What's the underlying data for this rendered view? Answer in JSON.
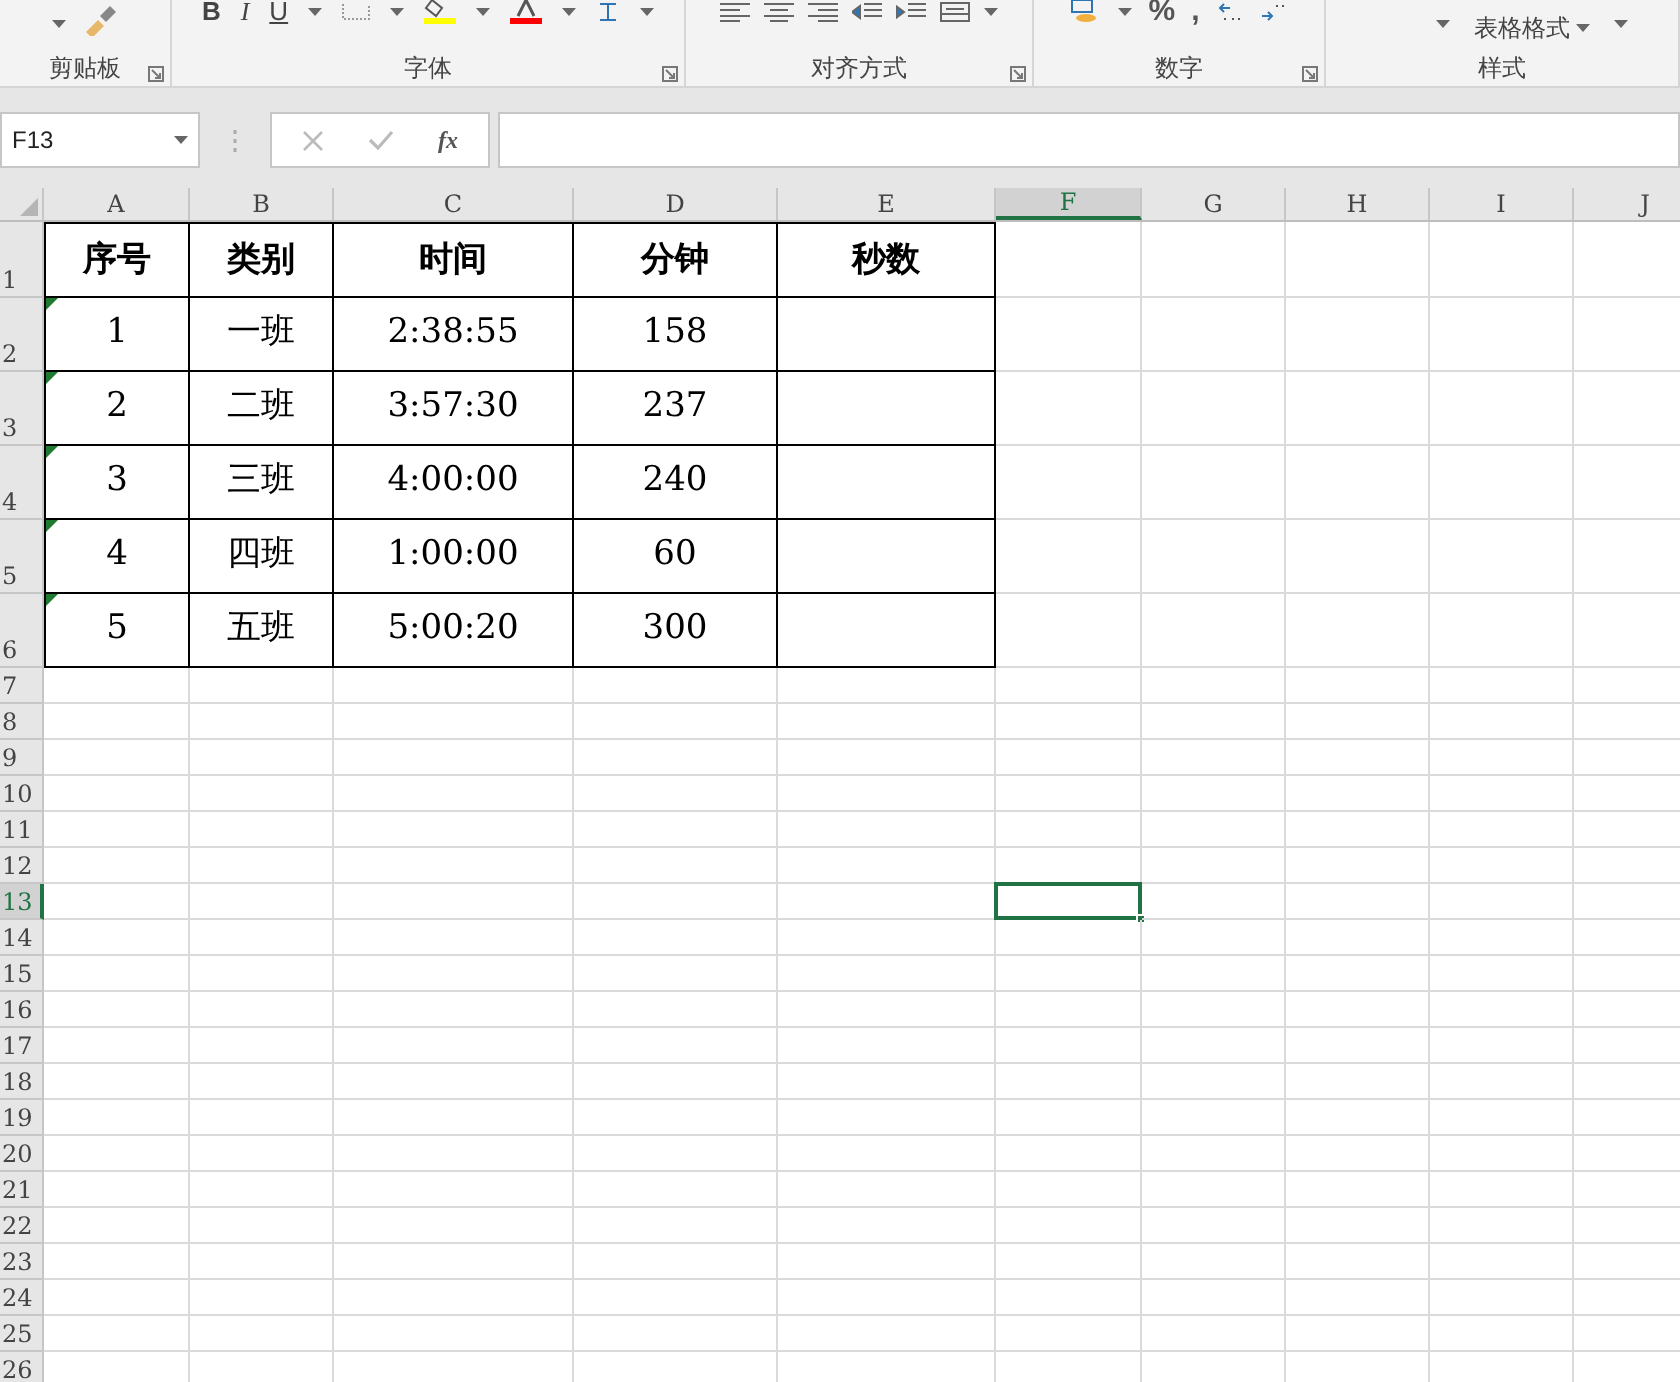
{
  "ribbon": {
    "groups": [
      {
        "kind": "clipboard",
        "label": "剪贴板"
      },
      {
        "kind": "font",
        "label": "字体",
        "buttons": [
          "B",
          "I",
          "U"
        ]
      },
      {
        "kind": "alignment",
        "label": "对齐方式"
      },
      {
        "kind": "number",
        "label": "数字",
        "buttons": [
          "%",
          ","
        ]
      },
      {
        "kind": "styles",
        "label": "样式",
        "buttons": [
          "表格格式"
        ]
      }
    ]
  },
  "formula_bar": {
    "name_box": "F13",
    "function_label": "fx"
  },
  "sheet": {
    "columns": [
      {
        "label": "A",
        "selected": false
      },
      {
        "label": "B",
        "selected": false
      },
      {
        "label": "C",
        "selected": false
      },
      {
        "label": "D",
        "selected": false
      },
      {
        "label": "E",
        "selected": false
      },
      {
        "label": "F",
        "selected": true
      },
      {
        "label": "G",
        "selected": false
      },
      {
        "label": "H",
        "selected": false
      },
      {
        "label": "I",
        "selected": false
      },
      {
        "label": "J",
        "selected": false
      }
    ],
    "rows": [
      {
        "label": "1",
        "kind": "header",
        "selected": false,
        "cells": [
          "序号",
          "类别",
          "时间",
          "分钟",
          "秒数"
        ]
      },
      {
        "label": "2",
        "kind": "data",
        "selected": false,
        "flagged": true,
        "cells": [
          "1",
          "一班",
          "2:38:55",
          "158"
        ]
      },
      {
        "label": "3",
        "kind": "data",
        "selected": false,
        "flagged": true,
        "cells": [
          "2",
          "二班",
          "3:57:30",
          "237"
        ]
      },
      {
        "label": "4",
        "kind": "data",
        "selected": false,
        "flagged": true,
        "cells": [
          "3",
          "三班",
          "4:00:00",
          "240"
        ]
      },
      {
        "label": "5",
        "kind": "data",
        "selected": false,
        "flagged": true,
        "cells": [
          "4",
          "四班",
          "1:00:00",
          "60"
        ]
      },
      {
        "label": "6",
        "kind": "data",
        "selected": false,
        "flagged": true,
        "cells": [
          "5",
          "五班",
          "5:00:20",
          "300"
        ]
      },
      {
        "label": "7",
        "kind": "empty",
        "selected": false
      },
      {
        "label": "8",
        "kind": "empty",
        "selected": false
      },
      {
        "label": "9",
        "kind": "empty",
        "selected": false
      },
      {
        "label": "10",
        "kind": "empty",
        "selected": false
      },
      {
        "label": "11",
        "kind": "empty",
        "selected": false
      },
      {
        "label": "12",
        "kind": "empty",
        "selected": false
      },
      {
        "label": "13",
        "kind": "empty",
        "selected": true
      },
      {
        "label": "14",
        "kind": "empty",
        "selected": false
      },
      {
        "label": "15",
        "kind": "empty",
        "selected": false
      },
      {
        "label": "16",
        "kind": "empty",
        "selected": false
      },
      {
        "label": "17",
        "kind": "empty",
        "selected": false
      },
      {
        "label": "18",
        "kind": "empty",
        "selected": false
      },
      {
        "label": "19",
        "kind": "empty",
        "selected": false
      },
      {
        "label": "20",
        "kind": "empty",
        "selected": false
      },
      {
        "label": "21",
        "kind": "empty",
        "selected": false
      },
      {
        "label": "22",
        "kind": "empty",
        "selected": false
      },
      {
        "label": "23",
        "kind": "empty",
        "selected": false
      },
      {
        "label": "24",
        "kind": "empty",
        "selected": false
      },
      {
        "label": "25",
        "kind": "empty",
        "selected": false
      },
      {
        "label": "26",
        "kind": "empty",
        "selected": false
      }
    ]
  }
}
